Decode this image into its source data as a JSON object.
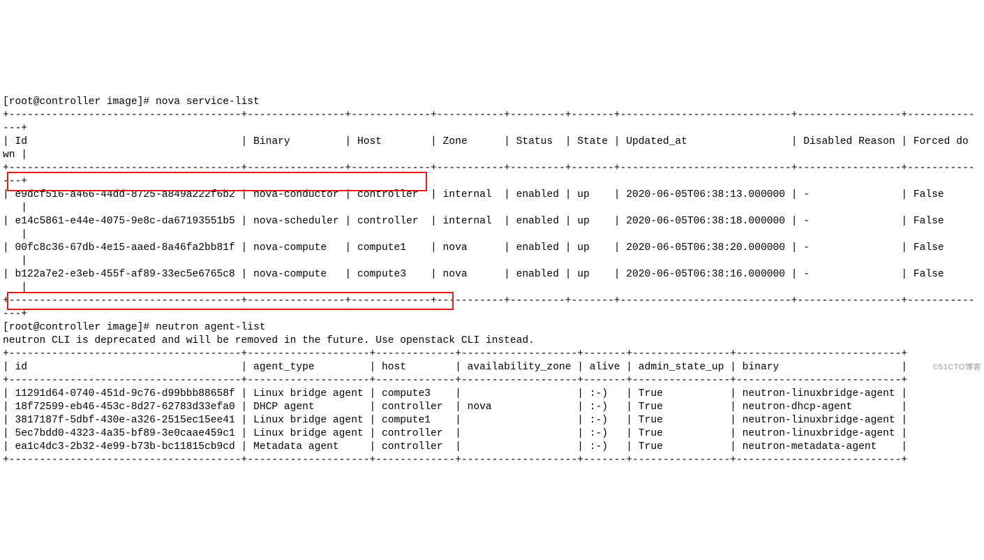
{
  "prompt1": "[root@controller image]# ",
  "cmd1": "nova service-list",
  "sep1a": "+--------------------------------------+----------------+-------------+-----------+---------+-------+----------------------------+-----------------+-----------",
  "sep1b": "---+",
  "hdr_id": "Id",
  "hdr_binary": "Binary",
  "hdr_host": "Host",
  "hdr_zone": "Zone",
  "hdr_status": "Status",
  "hdr_state": "State",
  "hdr_updated": "Updated_at",
  "hdr_disabled": "Disabled Reason",
  "hdr_forced": "Forced do",
  "hdr_tail": "wn |",
  "r1_id": "e9dcf516-a466-44dd-8725-a849a222f6b2",
  "r1_bin": "nova-conductor",
  "r1_host": "controller",
  "r1_zone": "internal",
  "r1_status": "enabled",
  "r1_state": "up",
  "r1_upd": "2020-06-05T06:38:13.000000",
  "r1_dis": "-",
  "r1_fd": "False",
  "r2_id": "e14c5861-e44e-4075-9e8c-da67193551b5",
  "r2_bin": "nova-scheduler",
  "r2_host": "controller",
  "r2_zone": "internal",
  "r2_status": "enabled",
  "r2_state": "up",
  "r2_upd": "2020-06-05T06:38:18.000000",
  "r2_dis": "-",
  "r2_fd": "False",
  "r3_id": "00fc8c36-67db-4e15-aaed-8a46fa2bb81f",
  "r3_bin": "nova-compute",
  "r3_host": "compute1",
  "r3_zone": "nova",
  "r3_status": "enabled",
  "r3_state": "up",
  "r3_upd": "2020-06-05T06:38:20.000000",
  "r3_dis": "-",
  "r3_fd": "False",
  "r4_id": "b122a7e2-e3eb-455f-af89-33ec5e6765c8",
  "r4_bin": "nova-compute",
  "r4_host": "compute3",
  "r4_zone": "nova",
  "r4_status": "enabled",
  "r4_state": "up",
  "r4_upd": "2020-06-05T06:38:16.000000",
  "r4_dis": "-",
  "r4_fd": "False",
  "row_tail": "   |",
  "prompt2": "[root@controller image]# ",
  "cmd2": "neutron agent-list",
  "deprec": "neutron CLI is deprecated and will be removed in the future. Use openstack CLI instead.",
  "sep2": "+--------------------------------------+--------------------+-------------+-------------------+-------+----------------+---------------------------+",
  "h2_id": "id",
  "h2_type": "agent_type",
  "h2_host": "host",
  "h2_az": "availability_zone",
  "h2_alive": "alive",
  "h2_admin": "admin_state_up",
  "h2_bin": "binary",
  "n1_id": "11291d64-0740-451d-9c76-d99bbb88658f",
  "n1_type": "Linux bridge agent",
  "n1_host": "compute3",
  "n1_az": "",
  "n1_alive": ":-)",
  "n1_admin": "True",
  "n1_bin": "neutron-linuxbridge-agent",
  "n2_id": "18f72599-eb46-453c-8d27-62783d33efa0",
  "n2_type": "DHCP agent",
  "n2_host": "controller",
  "n2_az": "nova",
  "n2_alive": ":-)",
  "n2_admin": "True",
  "n2_bin": "neutron-dhcp-agent",
  "n3_id": "3817187f-5dbf-430e-a326-2515ec15ee41",
  "n3_type": "Linux bridge agent",
  "n3_host": "compute1",
  "n3_az": "",
  "n3_alive": ":-)",
  "n3_admin": "True",
  "n3_bin": "neutron-linuxbridge-agent",
  "n4_id": "5ec7bdd0-4323-4a35-bf89-3e0caae459c1",
  "n4_type": "Linux bridge agent",
  "n4_host": "controller",
  "n4_az": "",
  "n4_alive": ":-)",
  "n4_admin": "True",
  "n4_bin": "neutron-linuxbridge-agent",
  "n5_id": "ea1c4dc3-2b32-4e99-b73b-bc11815cb9cd",
  "n5_type": "Metadata agent",
  "n5_host": "controller",
  "n5_az": "",
  "n5_alive": ":-)",
  "n5_admin": "True",
  "n5_bin": "neutron-metadata-agent",
  "watermark": "©51CTO博客"
}
